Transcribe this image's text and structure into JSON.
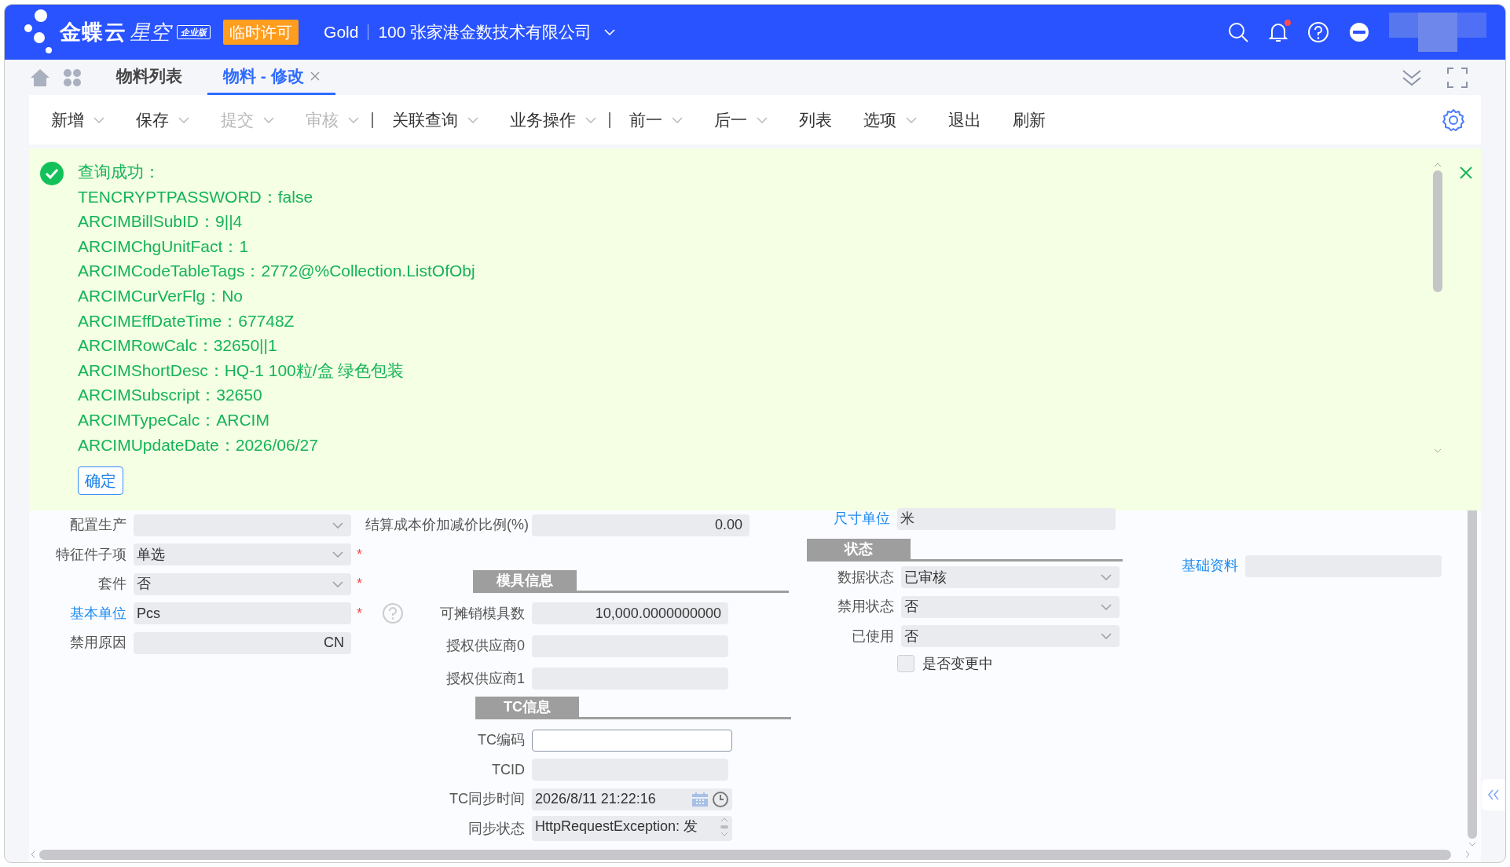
{
  "header": {
    "logo_text": "金蝶云",
    "logo_sub": "星空",
    "edition": "企业版",
    "license_badge": "临时许可",
    "data_center": "Gold",
    "organization": "100 张家港金数技术有限公司",
    "notification_unread": true
  },
  "tabs": [
    {
      "label": "物料列表",
      "selected": false,
      "closable": false
    },
    {
      "label": "物料 - 修改",
      "selected": true,
      "closable": true
    }
  ],
  "toolbar": [
    {
      "label": "新增",
      "dropdown": true,
      "disabled": false,
      "separator_after": false
    },
    {
      "label": "保存",
      "dropdown": true,
      "disabled": false,
      "separator_after": false
    },
    {
      "label": "提交",
      "dropdown": true,
      "disabled": true,
      "separator_after": false
    },
    {
      "label": "审核",
      "dropdown": true,
      "disabled": true,
      "separator_after": true
    },
    {
      "label": "关联查询",
      "dropdown": true,
      "disabled": false,
      "separator_after": false
    },
    {
      "label": "业务操作",
      "dropdown": true,
      "disabled": false,
      "separator_after": true
    },
    {
      "label": "前一",
      "dropdown": true,
      "disabled": false,
      "separator_after": false
    },
    {
      "label": "后一",
      "dropdown": true,
      "disabled": false,
      "separator_after": false
    },
    {
      "label": "列表",
      "dropdown": false,
      "disabled": false,
      "separator_after": false
    },
    {
      "label": "选项",
      "dropdown": true,
      "disabled": false,
      "separator_after": false
    },
    {
      "label": "退出",
      "dropdown": false,
      "disabled": false,
      "separator_after": false
    },
    {
      "label": "刷新",
      "dropdown": false,
      "disabled": false,
      "separator_after": false
    }
  ],
  "message": {
    "title": "查询成功：",
    "lines": [
      "TENCRYPTPASSWORD：false",
      "ARCIMBillSubID：9||4",
      "ARCIMChgUnitFact：1",
      "ARCIMCodeTableTags：2772@%Collection.ListOfObj",
      "ARCIMCurVerFlg：No",
      "ARCIMEffDateTime：67748Z",
      "ARCIMRowCalc：32650||1",
      "ARCIMShortDesc：HQ-1 100粒/盒 绿色包装",
      "ARCIMSubscript：32650",
      "ARCIMTypeCalc：ARCIM",
      "ARCIMUpdateDate：2026/06/27"
    ],
    "confirm_button": "确定"
  },
  "form": {
    "column_1": [
      {
        "label": "配置生产",
        "kind": "select",
        "link": false
      },
      {
        "label": "特征件子项",
        "kind": "select",
        "value": "单选",
        "required_mark": "*",
        "link": false
      },
      {
        "label": "套件",
        "kind": "select",
        "value": "否",
        "required_mark": "*",
        "link": false
      },
      {
        "label": "基本单位",
        "kind": "text",
        "value": "Pcs",
        "required_mark": "*",
        "link": true,
        "help": true
      },
      {
        "label": "禁用原因",
        "kind": "right_text",
        "value": "CN",
        "link": false
      }
    ],
    "column_2_top": {
      "label": "结算成本价加减价比例(%)",
      "kind": "right_text",
      "value": "0.00",
      "link": false
    },
    "sections_2": [
      {
        "title": "模具信息",
        "fields": [
          {
            "label": "可摊销模具数",
            "kind": "right_text",
            "value": "10,000.0000000000",
            "link": false
          },
          {
            "label": "授权供应商0",
            "kind": "text",
            "link": false
          },
          {
            "label": "授权供应商1",
            "kind": "text",
            "link": false
          }
        ]
      },
      {
        "title": "TC信息",
        "fields": [
          {
            "label": "TC编码",
            "kind": "input",
            "link": false
          },
          {
            "label": "TCID",
            "kind": "text",
            "link": false
          },
          {
            "label": "TC同步时间",
            "kind": "datetime",
            "value": "2026/8/11 21:22:16",
            "link": false
          },
          {
            "label": "同步状态",
            "kind": "textarea",
            "value": "HttpRequestException: 发",
            "link": false
          }
        ]
      }
    ],
    "column_3_top": {
      "label": "尺寸单位",
      "kind": "text",
      "value": "米",
      "link": true
    },
    "status_section": {
      "title": "状态",
      "fields": [
        {
          "label": "数据状态",
          "kind": "select",
          "value": "已审核",
          "link": false
        },
        {
          "label": "禁用状态",
          "kind": "select",
          "value": "否",
          "link": false
        },
        {
          "label": "已使用",
          "kind": "select",
          "value": "否",
          "link": false
        }
      ],
      "checkbox": {
        "label": "是否变更中",
        "checked": false
      }
    },
    "column_4": [
      {
        "label": "基础资料",
        "kind": "text",
        "link": true
      }
    ]
  }
}
